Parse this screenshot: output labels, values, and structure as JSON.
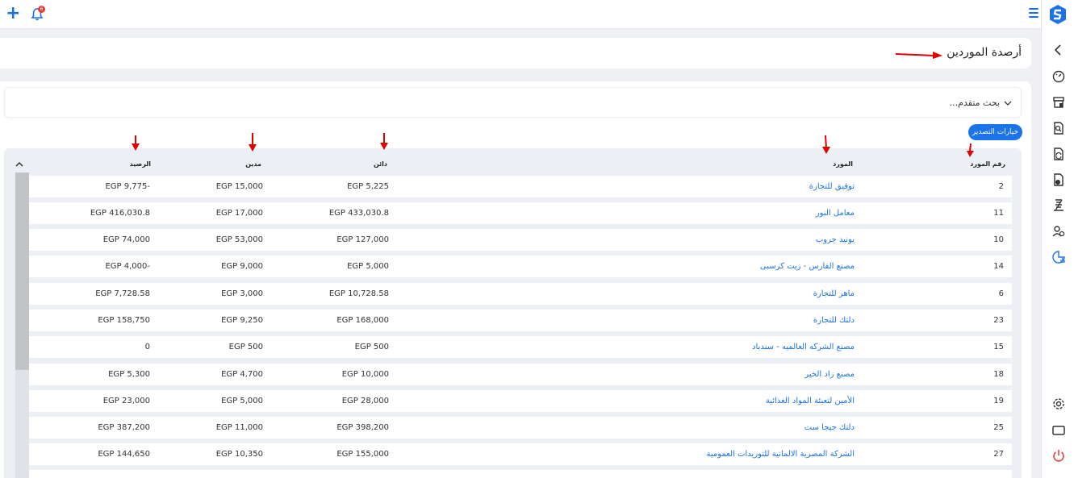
{
  "header": {
    "badge_count": "6"
  },
  "page": {
    "title": "أرصدة الموردين"
  },
  "search": {
    "label": "بحث متقدم..."
  },
  "actions": {
    "export_label": "خيارات التصدير"
  },
  "table": {
    "columns": {
      "number": "رقم المورد",
      "supplier": "المورد",
      "credit": "دائن",
      "debit": "مدين",
      "balance": "الرصيد"
    },
    "rows": [
      {
        "number": "2",
        "supplier": "توفيق للتجارة",
        "credit": "EGP 5,225",
        "debit": "EGP 15,000",
        "balance": "EGP 9,775-"
      },
      {
        "number": "11",
        "supplier": "معامل النور",
        "credit": "EGP 433,030.8",
        "debit": "EGP 17,000",
        "balance": "EGP 416,030.8"
      },
      {
        "number": "10",
        "supplier": "يونيد جروب",
        "credit": "EGP 127,000",
        "debit": "EGP 53,000",
        "balance": "EGP 74,000"
      },
      {
        "number": "14",
        "supplier": "مصنع الفارس - زيت كرسبى",
        "credit": "EGP 5,000",
        "debit": "EGP 9,000",
        "balance": "EGP 4,000-"
      },
      {
        "number": "6",
        "supplier": "ماهر للتجارة",
        "credit": "EGP 10,728.58",
        "debit": "EGP 3,000",
        "balance": "EGP 7,728.58"
      },
      {
        "number": "23",
        "supplier": "دلتك للتجارة",
        "credit": "EGP 168,000",
        "debit": "EGP 9,250",
        "balance": "EGP 158,750"
      },
      {
        "number": "15",
        "supplier": "مصنع الشركه العالميه - سندباد",
        "credit": "EGP 500",
        "debit": "EGP 500",
        "balance": "0"
      },
      {
        "number": "18",
        "supplier": "مصنع زاد الخير",
        "credit": "EGP 10,000",
        "debit": "EGP 4,700",
        "balance": "EGP 5,300"
      },
      {
        "number": "19",
        "supplier": "الأمين لتعبئة المواد الغذائية",
        "credit": "EGP 28,000",
        "debit": "EGP 5,000",
        "balance": "EGP 23,000"
      },
      {
        "number": "25",
        "supplier": "دلتك جيجا ست",
        "credit": "EGP 398,200",
        "debit": "EGP 11,000",
        "balance": "EGP 387,200"
      },
      {
        "number": "27",
        "supplier": "الشركة المصرية الالمانية للتوريدات العمومية",
        "credit": "EGP 155,000",
        "debit": "EGP 10,350",
        "balance": "EGP 144,650"
      }
    ]
  },
  "colors": {
    "accent": "#1a73e8",
    "arrow": "#e00000"
  },
  "icons": [
    "plus-icon",
    "bell-icon",
    "menu-icon",
    "logo-icon",
    "chevron-left-icon",
    "dashboard-icon",
    "store-icon",
    "search-document-icon",
    "sync-document-icon",
    "payment-document-icon",
    "reports-icon",
    "users-icon",
    "chart-icon",
    "settings-icon",
    "window-icon",
    "power-icon"
  ]
}
